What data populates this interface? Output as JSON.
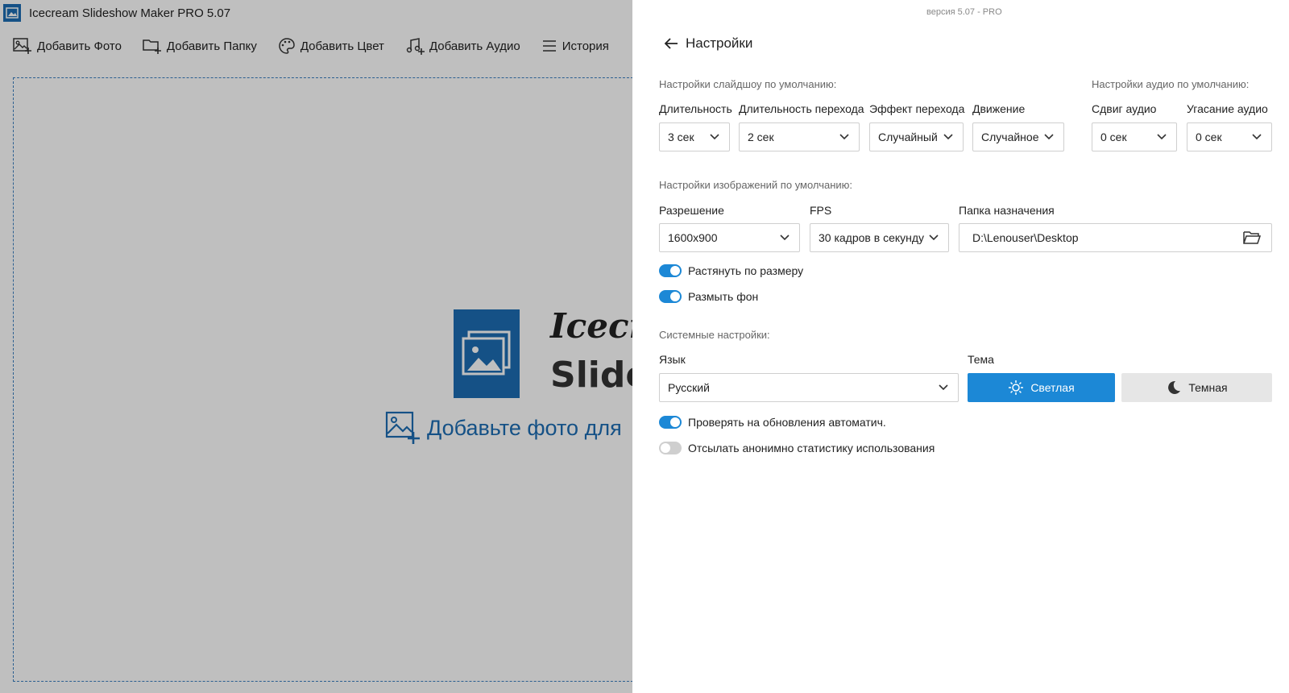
{
  "app": {
    "title": "Icecream Slideshow Maker PRO 5.07",
    "toolbar": [
      {
        "label": "Добавить Фото",
        "icon": "add-photo-icon"
      },
      {
        "label": "Добавить Папку",
        "icon": "add-folder-icon"
      },
      {
        "label": "Добавить Цвет",
        "icon": "palette-icon"
      },
      {
        "label": "Добавить Аудио",
        "icon": "add-audio-icon"
      },
      {
        "label": "История",
        "icon": "menu-icon"
      }
    ],
    "logo_line1": "Icecr",
    "logo_line2": "Slide",
    "add_hint": "Добавьте фото для"
  },
  "settings": {
    "version": "версия 5.07 - PRO",
    "title": "Настройки",
    "slideshow": {
      "section": "Настройки слайдшоу по умолчанию:",
      "duration": {
        "label": "Длительность",
        "value": "3 сек"
      },
      "transition_duration": {
        "label": "Длительность перехода",
        "value": "2 сек"
      },
      "transition_effect": {
        "label": "Эффект перехода",
        "value": "Случайный"
      },
      "motion": {
        "label": "Движение",
        "value": "Случайное"
      }
    },
    "audio": {
      "section": "Настройки аудио по умолчанию:",
      "shift": {
        "label": "Сдвиг аудио",
        "value": "0 сек"
      },
      "fade": {
        "label": "Угасание аудио",
        "value": "0 сек"
      }
    },
    "image": {
      "section": "Настройки изображений по умолчанию:",
      "resolution": {
        "label": "Разрешение",
        "value": "1600x900"
      },
      "fps": {
        "label": "FPS",
        "value": "30 кадров в секунду"
      },
      "folder": {
        "label": "Папка назначения",
        "value": "D:\\Lenouser\\Desktop"
      },
      "stretch": {
        "label": "Растянуть по размеру",
        "on": true
      },
      "blur": {
        "label": "Размыть фон",
        "on": true
      }
    },
    "system": {
      "section": "Системные настройки:",
      "language": {
        "label": "Язык",
        "value": "Русский"
      },
      "theme": {
        "label": "Тема",
        "light": "Светлая",
        "dark": "Темная",
        "selected": "light"
      },
      "updates": {
        "label": "Проверять на обновления автоматич.",
        "on": true
      },
      "stats": {
        "label": "Отсылать анонимно статистику использования",
        "on": false
      }
    }
  },
  "colors": {
    "accent": "#1c88d6",
    "brand": "#1c6db3"
  }
}
